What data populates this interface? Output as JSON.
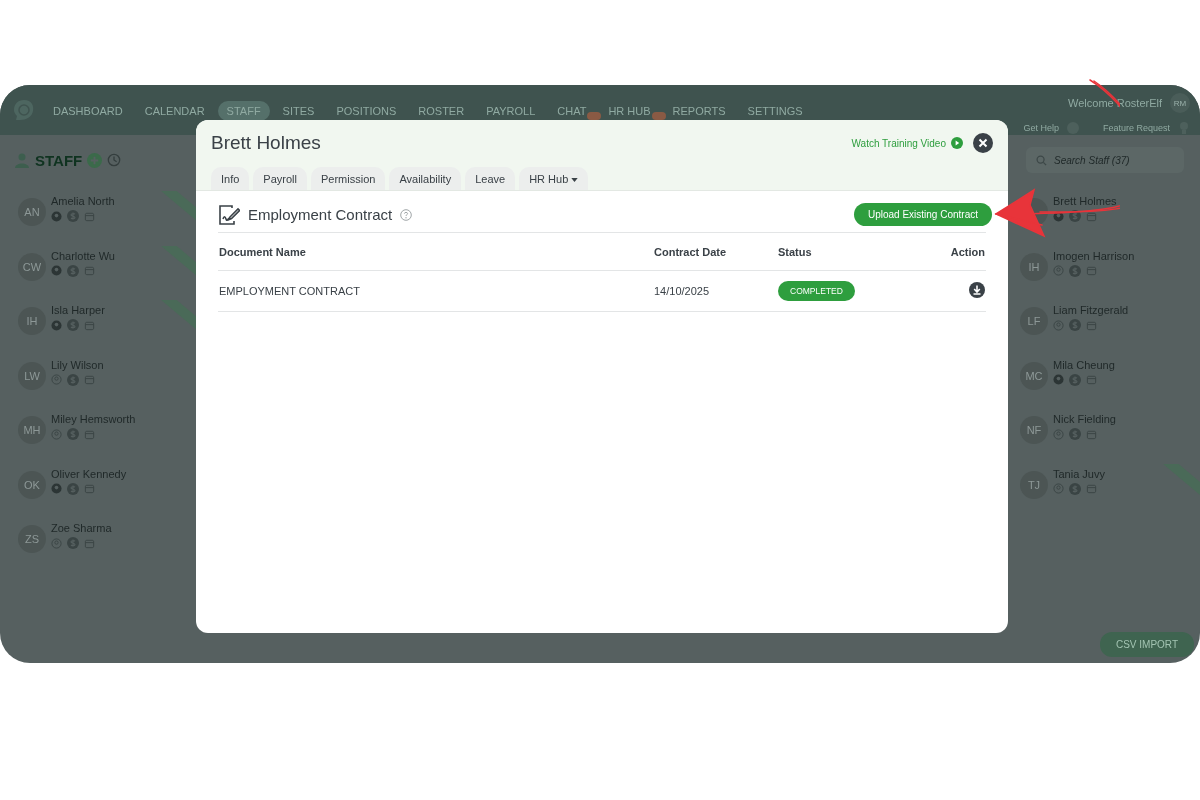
{
  "app": {
    "nav": [
      {
        "label": "DASHBOARD",
        "selected": false,
        "badge": false
      },
      {
        "label": "CALENDAR",
        "selected": false,
        "badge": false
      },
      {
        "label": "STAFF",
        "selected": true,
        "badge": false
      },
      {
        "label": "SITES",
        "selected": false,
        "badge": false
      },
      {
        "label": "POSITIONS",
        "selected": false,
        "badge": false
      },
      {
        "label": "ROSTER",
        "selected": false,
        "badge": false
      },
      {
        "label": "PAYROLL",
        "selected": false,
        "badge": false
      },
      {
        "label": "CHAT",
        "selected": false,
        "badge": true
      },
      {
        "label": "HR HUB",
        "selected": false,
        "badge": true
      },
      {
        "label": "REPORTS",
        "selected": false,
        "badge": false
      },
      {
        "label": "SETTINGS",
        "selected": false,
        "badge": false
      }
    ],
    "welcome": "Welcome RosterElf",
    "avatar": "RM",
    "help": "Get Help",
    "feature": "Feature Request",
    "staff_title": "STAFF",
    "search": {
      "placeholder": "Search Staff (37)"
    },
    "staff_left": [
      {
        "initials": "AN",
        "name": "Amelia North",
        "profile": true,
        "ribbon": true
      },
      {
        "initials": "CW",
        "name": "Charlotte Wu",
        "profile": true,
        "ribbon": true
      },
      {
        "initials": "IH",
        "name": "Isla Harper",
        "profile": true,
        "ribbon": true
      },
      {
        "initials": "LW",
        "name": "Lily Wilson",
        "profile": false,
        "ribbon": false
      },
      {
        "initials": "MH",
        "name": "Miley Hemsworth",
        "profile": false,
        "ribbon": false
      },
      {
        "initials": "OK",
        "name": "Oliver Kennedy",
        "profile": true,
        "ribbon": false
      },
      {
        "initials": "ZS",
        "name": "Zoe Sharma",
        "profile": false,
        "ribbon": false
      }
    ],
    "staff_right": [
      {
        "name": "Brett Holmes",
        "profile": true,
        "ribbon": false
      },
      {
        "initials": "IH",
        "name": "Imogen Harrison",
        "profile": false,
        "ribbon": false
      },
      {
        "initials": "LF",
        "name": "Liam Fitzgerald",
        "profile": false,
        "ribbon": false
      },
      {
        "initials": "MC",
        "name": "Mila Cheung",
        "profile": true,
        "ribbon": false
      },
      {
        "initials": "NF",
        "name": "Nick Fielding",
        "profile": false,
        "ribbon": false
      },
      {
        "initials": "TJ",
        "name": "Tania Juvy",
        "profile": false,
        "ribbon": true
      }
    ],
    "csv_button": "CSV IMPORT"
  },
  "modal": {
    "title": "Brett Holmes",
    "training_link": "Watch Training Video",
    "tabs": [
      {
        "label": "Info",
        "selected": false,
        "dropdown": false
      },
      {
        "label": "Payroll",
        "selected": false,
        "dropdown": false
      },
      {
        "label": "Permission",
        "selected": false,
        "dropdown": false
      },
      {
        "label": "Availability",
        "selected": false,
        "dropdown": false
      },
      {
        "label": "Leave",
        "selected": false,
        "dropdown": false
      },
      {
        "label": "HR Hub",
        "selected": false,
        "dropdown": true
      }
    ],
    "section_title": "Employment Contract",
    "upload_button": "Upload Existing Contract",
    "table": {
      "columns": [
        "Document Name",
        "Contract Date",
        "Status",
        "Action"
      ],
      "rows": [
        {
          "document": "EMPLOYMENT CONTRACT",
          "date": "14/10/2025",
          "status": "COMPLETED"
        }
      ]
    }
  }
}
